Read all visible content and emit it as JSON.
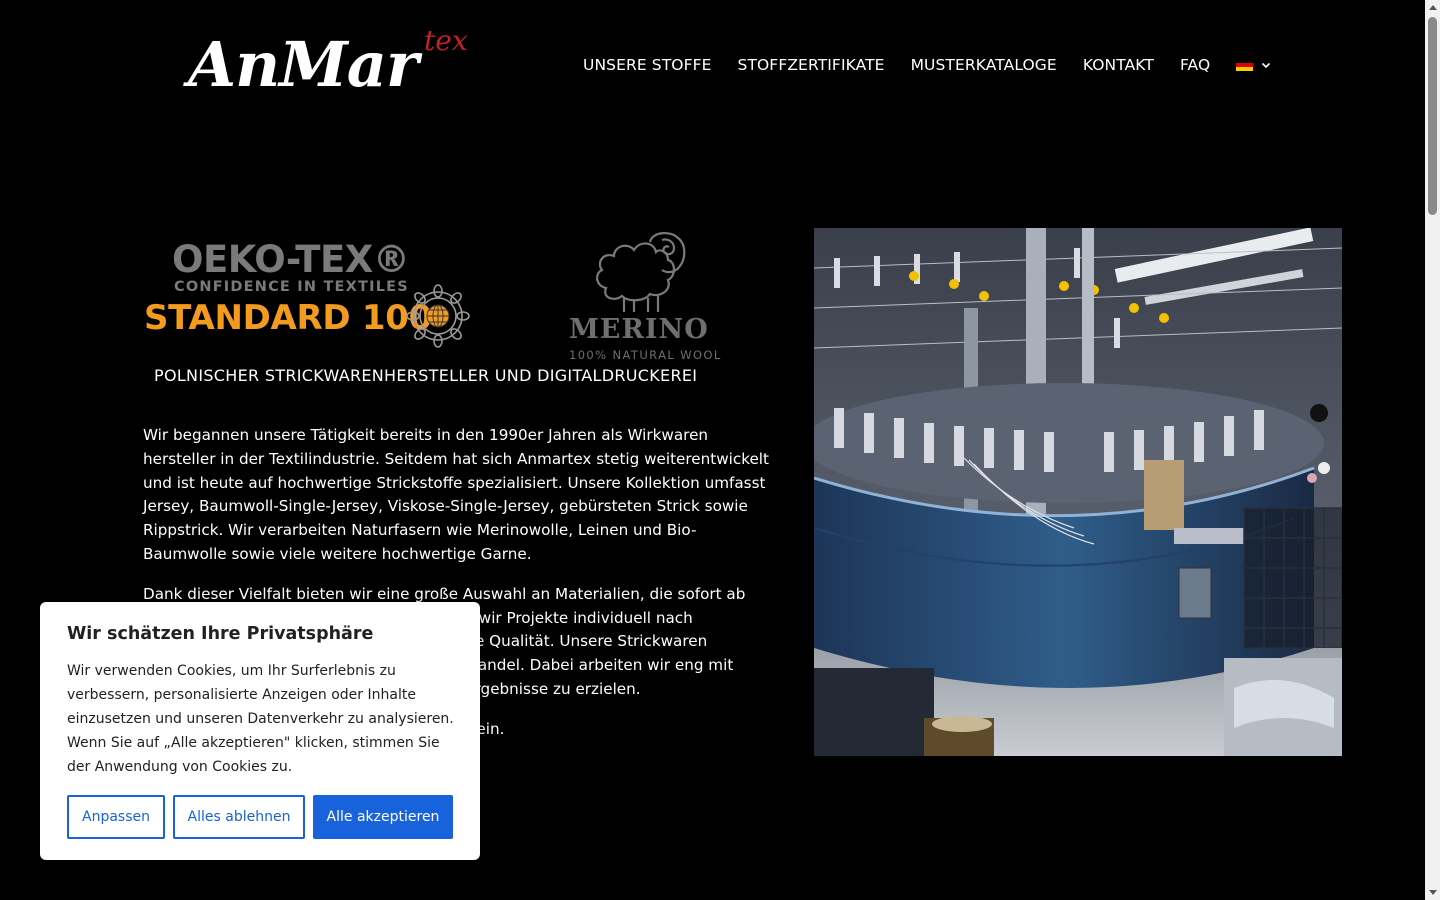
{
  "header": {
    "logo_text": "AnMar",
    "logo_sup": "tex",
    "nav": [
      {
        "label": "UNSERE STOFFE"
      },
      {
        "label": "STOFFZERTIFIKATE"
      },
      {
        "label": "MUSTERKATALOGE"
      },
      {
        "label": "KONTAKT"
      },
      {
        "label": "FAQ"
      }
    ],
    "language": "German flag",
    "flag_colors": [
      "#000000",
      "#dd0000",
      "#ffce00"
    ]
  },
  "badges": {
    "oeko": {
      "title": "OEKO-TEX®",
      "subtitle": "CONFIDENCE IN TEXTILES",
      "standard": "STANDARD 100"
    },
    "merino": {
      "title": "MERINO",
      "subtitle": "100% NATURAL WOOL"
    }
  },
  "main": {
    "tagline": "POLNISCHER STRICKWARENHERSTELLER UND DIGITALDRUCKEREI",
    "paragraphs": [
      "Wir begannen unsere Tätigkeit bereits in den 1990er Jahren als Wirkwaren hersteller in der Textilindustrie. Seitdem hat sich Anmartex stetig weiterentwickelt und ist heute auf hochwertige Strickstoffe spezialisiert. Unsere Kollektion umfasst Jersey, Baumwoll-Single-Jersey, Viskose-Single-Jersey, gebürsteten Strick sowie Rippstrick. Wir verarbeiten Naturfasern wie Merinowolle, Leinen und Bio-Baumwolle sowie viele weitere hochwertige Garne.",
      "Dank dieser Vielfalt bieten wir eine große Auswahl an Materialien, die sofort ab Lager verfügbar sind. Außerdem realisieren wir Projekte individuell nach Kundenwunsch und achten stets auf höchste Qualität. Unsere Strickwaren beliefern Bekleidungshersteller sowie den Handel. Dabei arbeiten wir eng mit unseren Kunden zusammen, um optimale Ergebnisse zu erzielen.",
      "Wir laden Sie herzlich zur Zusammenarbeit ein."
    ]
  },
  "photo": {
    "alt": "circular knitting machine"
  },
  "cookie": {
    "title": "Wir schätzen Ihre Privatsphäre",
    "text": "Wir verwenden Cookies, um Ihr Surferlebnis zu verbessern, personalisierte Anzeigen oder Inhalte einzusetzen und unseren Datenverkehr zu analysieren. Wenn Sie auf „Alle akzeptieren\" klicken, stimmen Sie der Anwendung von Cookies zu.",
    "btn_customize": "Anpassen",
    "btn_reject": "Alles ablehnen",
    "btn_accept": "Alle akzeptieren",
    "accent": "#1863dc"
  }
}
